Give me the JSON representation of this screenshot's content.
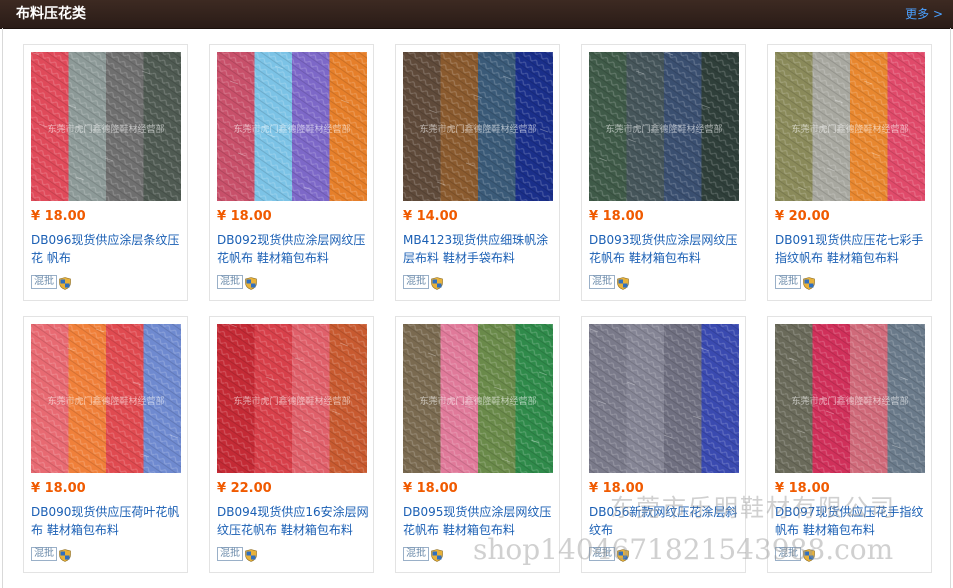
{
  "header": {
    "title": "布料压花类",
    "more_label": "更多 >"
  },
  "badges": {
    "mix_label": "混批"
  },
  "products": [
    {
      "price": "¥ 18.00",
      "name": "DB096现货供应涂层条纹压花 帆布",
      "swatch_colors": [
        "#e04a5a",
        "#8d9a98",
        "#6f6f6f",
        "#4f5a52"
      ],
      "image_text": "东莞市虎门鑫德隆鞋材经营部"
    },
    {
      "price": "¥ 18.00",
      "name": "DB092现货供应涂层网纹压花帆布 鞋材箱包布料",
      "swatch_colors": [
        "#c8506a",
        "#7cc3e6",
        "#7d68c8",
        "#e67f2a"
      ],
      "image_text": "东莞市虎门鑫德隆鞋材经营部"
    },
    {
      "price": "¥ 14.00",
      "name": "MB4123现货供应细珠帆涂层布料 鞋材手袋布料",
      "swatch_colors": [
        "#5f4a3a",
        "#8a5a2e",
        "#3a5a78",
        "#1a2f8a"
      ],
      "image_text": "东莞市虎门鑫德隆鞋材经营部"
    },
    {
      "price": "¥ 18.00",
      "name": "DB093现货供应涂层网纹压花帆布 鞋材箱包布料",
      "swatch_colors": [
        "#3f5a48",
        "#45555a",
        "#3a4f70",
        "#2f3f3a"
      ],
      "image_text": "东莞市虎门鑫德隆鞋材经营部"
    },
    {
      "price": "¥ 20.00",
      "name": "DB091现货供应压花七彩手指纹帆布 鞋材箱包布料",
      "swatch_colors": [
        "#8a8a5a",
        "#a8a8a0",
        "#e8872f",
        "#e04a6a"
      ],
      "image_text": "东莞市虎门鑫德隆鞋材经营部"
    },
    {
      "price": "¥ 18.00",
      "name": "DB090现货供应压荷叶花帆布 鞋材箱包布料",
      "swatch_colors": [
        "#e86a72",
        "#f0803a",
        "#e04a50",
        "#6f8ad0"
      ],
      "image_text": "东莞市虎门鑫德隆鞋材经营部"
    },
    {
      "price": "¥ 22.00",
      "name": "DB094现货供应16安涂层网纹压花帆布 鞋材箱包布料",
      "swatch_colors": [
        "#c42a35",
        "#d8404a",
        "#e0606a",
        "#c85a30"
      ],
      "image_text": "东莞市虎门鑫德隆鞋材经营部"
    },
    {
      "price": "¥ 18.00",
      "name": "DB095现货供应涂层网纹压花帆布 鞋材箱包布料",
      "swatch_colors": [
        "#7a6a50",
        "#e07a9a",
        "#6a8a4a",
        "#2f8a4a"
      ],
      "image_text": "东莞市虎门鑫德隆鞋材经营部"
    },
    {
      "price": "¥ 18.00",
      "name": "DB056新款网纹压花涂层斜纹布",
      "swatch_colors": [
        "#7a7a8a",
        "#858595",
        "#6f6f80",
        "#3a4ab0"
      ],
      "image_text": ""
    },
    {
      "price": "¥ 18.00",
      "name": "DB097现货供应压花手指纹帆布 鞋材箱包布料",
      "swatch_colors": [
        "#6a6a5a",
        "#d0305a",
        "#d06a7a",
        "#6a7a8a"
      ],
      "image_text": "东莞市虎门鑫德隆鞋材经营部"
    }
  ],
  "watermark": {
    "company": "东莞市乐明鞋材有限公司",
    "shop": "shop1404671821543988.com"
  }
}
